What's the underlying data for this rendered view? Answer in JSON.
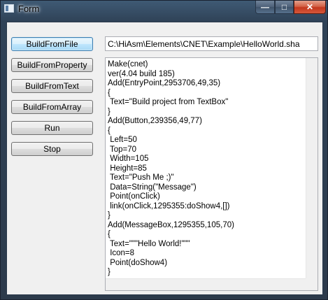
{
  "window": {
    "title": "Form",
    "controls": {
      "minimize": "—",
      "maximize": "□",
      "close": "✕"
    }
  },
  "buttons": [
    {
      "label": "BuildFromFile"
    },
    {
      "label": "BuildFromProperty"
    },
    {
      "label": "BuildFromText"
    },
    {
      "label": "BuildFromArray"
    },
    {
      "label": "Run"
    },
    {
      "label": "Stop"
    }
  ],
  "path_input": {
    "value": "C:\\HiAsm\\Elements\\CNET\\Example\\HelloWorld.sha"
  },
  "memo": {
    "text": "Make(cnet)\nver(4.04 build 185)\nAdd(EntryPoint,2953706,49,35)\n{\n Text=\"Build project from TextBox\"\n}\nAdd(Button,239356,49,77)\n{\n Left=50\n Top=70\n Width=105\n Height=85\n Text=\"Push Me ;)\"\n Data=String(\"Message\")\n Point(onClick)\n link(onClick,1295355:doShow4,[])\n}\nAdd(MessageBox,1295355,105,70)\n{\n Text=\"\"\"Hello World!\"\"\"\n Icon=8\n Point(doShow4)\n}"
  }
}
